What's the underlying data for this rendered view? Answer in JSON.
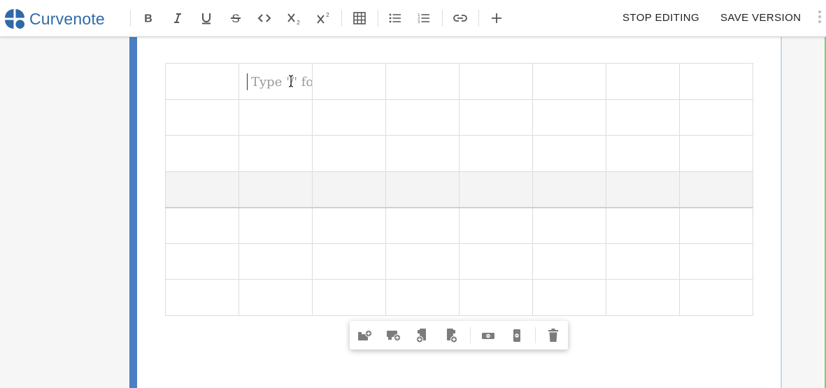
{
  "app": {
    "name": "Curvenote",
    "brand_color": "#2f6aa8",
    "accent_color": "#4a80c3"
  },
  "toolbar": {
    "format_buttons": [
      {
        "icon": "bold-icon",
        "label": "B"
      },
      {
        "icon": "italic-icon",
        "label": "I"
      },
      {
        "icon": "underline-icon",
        "label": "U"
      },
      {
        "icon": "strikethrough-icon",
        "label": "S"
      },
      {
        "icon": "code-icon",
        "label": "<>"
      },
      {
        "icon": "subscript-icon",
        "label": "X₂"
      },
      {
        "icon": "superscript-icon",
        "label": "X²"
      }
    ],
    "insert_buttons": [
      {
        "icon": "table-icon"
      },
      {
        "icon": "bullet-list-icon"
      },
      {
        "icon": "numbered-list-icon"
      },
      {
        "icon": "link-icon"
      },
      {
        "icon": "plus-icon"
      }
    ],
    "stop_editing_label": "STOP EDITING",
    "save_version_label": "SAVE VERSION"
  },
  "table": {
    "rows": 7,
    "columns": 8,
    "selected_row": 4,
    "active_cell": {
      "row": 1,
      "column": 2,
      "placeholder": "Type '/' for commands"
    }
  },
  "table_toolbar": {
    "buttons": [
      {
        "icon": "insert-row-above-icon"
      },
      {
        "icon": "insert-row-below-icon"
      },
      {
        "icon": "insert-column-left-icon"
      },
      {
        "icon": "insert-column-right-icon"
      },
      {
        "icon": "delete-row-icon"
      },
      {
        "icon": "delete-column-icon"
      },
      {
        "icon": "delete-table-icon"
      }
    ]
  }
}
